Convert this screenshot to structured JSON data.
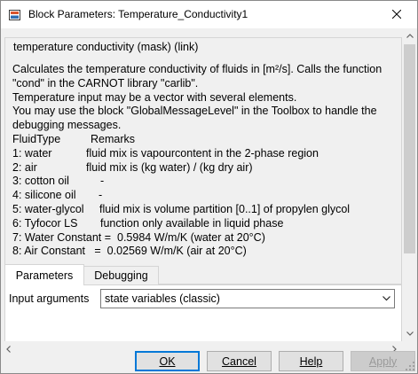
{
  "window": {
    "title": "Block Parameters: Temperature_Conductivity1"
  },
  "group": {
    "legend": "temperature conductivity (mask) (link)",
    "description": [
      "Calculates the temperature conductivity of fluids in [m²/s]. Calls the function \"cond\" in the CARNOT library \"carlib\".",
      "Temperature input may be a vector with several elements.",
      "You may use the block \"GlobalMessageLevel\" in the Toolbox to handle the debugging messages."
    ],
    "fluid_table": {
      "header": {
        "name": "FluidType",
        "remark": "Remarks"
      },
      "rows": [
        {
          "name": "1: water",
          "remark": "fluid mix is vapourcontent in the 2-phase region"
        },
        {
          "name": "2: air",
          "remark": "fluid mix is (kg water) / (kg dry air)"
        },
        {
          "name": "3: cotton oil",
          "remark": "-"
        },
        {
          "name": "4: silicone oil",
          "remark": "-"
        },
        {
          "name": "5: water-glycol",
          "remark": "fluid mix is volume partition [0..1] of propylen glycol"
        },
        {
          "name": "6: Tyfocor LS",
          "remark": "function only available in liquid phase"
        }
      ]
    },
    "constants": [
      "7: Water Constant =  0.5984 W/m/K (water at 20°C)",
      "8: Air Constant   =  0.02569 W/m/K (air at 20°C)"
    ]
  },
  "tabs": [
    {
      "label": "Parameters",
      "active": true
    },
    {
      "label": "Debugging",
      "active": false
    }
  ],
  "parameters": {
    "input_arguments_label": "Input arguments",
    "input_arguments_value": "state variables (classic)"
  },
  "buttons": {
    "ok": "OK",
    "cancel": "Cancel",
    "help": "Help",
    "apply": "Apply"
  },
  "colors": {
    "dialog_bg": "#f0f0f0",
    "default_button_border": "#0078d7",
    "disabled_text": "#9a9a9a"
  },
  "icons": [
    "simulink-block-icon",
    "close-icon",
    "scroll-up-icon",
    "scroll-down-icon",
    "scroll-left-icon",
    "scroll-right-icon",
    "dropdown-arrow-icon",
    "resize-grip-icon"
  ]
}
